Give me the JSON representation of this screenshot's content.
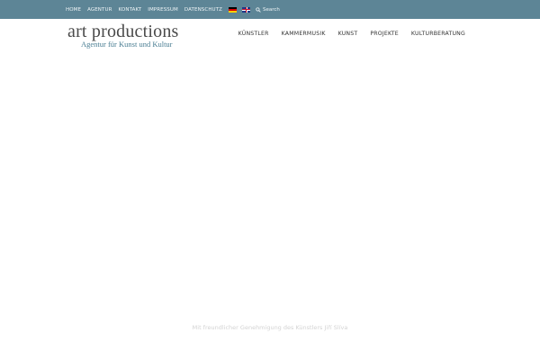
{
  "topbar": {
    "nav": [
      "HOME",
      "AGENTUR",
      "KONTAKT",
      "IMPRESSUM",
      "DATENSCHUTZ"
    ],
    "search_placeholder": "Search",
    "color": "#5d8596"
  },
  "logo": {
    "title": "art productions",
    "subtitle": "Agentur für Kunst und Kultur"
  },
  "mainnav": [
    "KÜNSTLER",
    "KAMMERMUSIK",
    "KUNST",
    "PROJEKTE",
    "KULTURBERATUNG"
  ],
  "caption": "Mit freundlicher Genehmigung des Künstlers Jiří Slíva"
}
